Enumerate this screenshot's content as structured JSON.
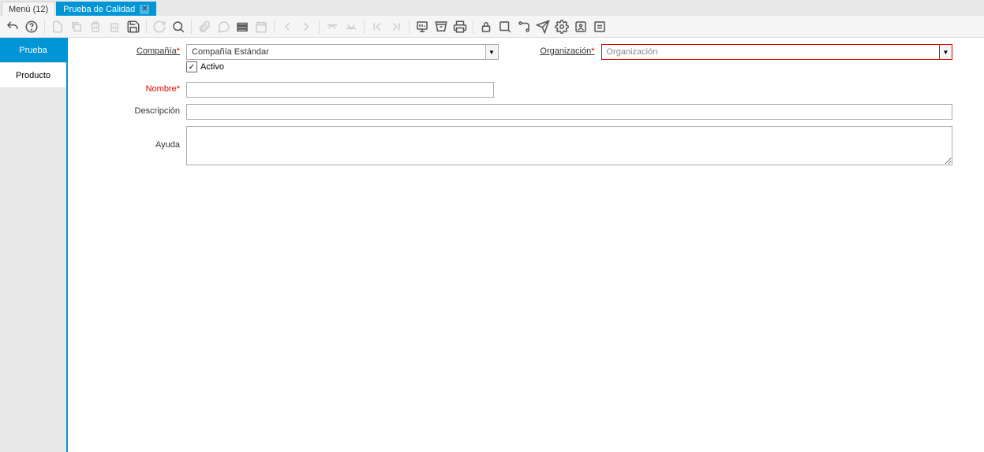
{
  "tabs": [
    {
      "label": "Menú (12)",
      "active": false,
      "closable": false
    },
    {
      "label": "Prueba de Calidad",
      "active": true,
      "closable": true
    }
  ],
  "sidebar": {
    "tabs": [
      {
        "label": "Prueba",
        "active": true
      },
      {
        "label": "Producto",
        "active": false
      }
    ]
  },
  "form": {
    "compania_label": "Compañía",
    "compania_value": "Compañía Estándar",
    "organizacion_label": "Organización",
    "organizacion_placeholder": "Organización",
    "activo_label": "Activo",
    "activo_checked": true,
    "nombre_label": "Nombre",
    "nombre_value": "",
    "descripcion_label": "Descripción",
    "descripcion_value": "",
    "ayuda_label": "Ayuda",
    "ayuda_value": ""
  }
}
